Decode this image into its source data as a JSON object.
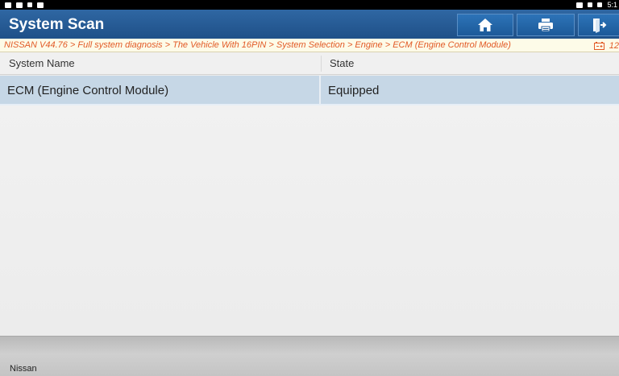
{
  "status_bar": {
    "time": "5:1",
    "left_icons": [
      "notification-icon",
      "image-icon",
      "usb-icon",
      "video-icon"
    ],
    "right_icons": [
      "cast-icon",
      "bluetooth-icon",
      "battery-icon"
    ]
  },
  "header": {
    "title": "System Scan",
    "buttons": [
      "home-icon",
      "print-icon",
      "exit-icon"
    ]
  },
  "breadcrumb": {
    "path": "NISSAN V44.76 > Full system diagnosis > The Vehicle With 16PIN > System Selection > Engine > ECM (Engine Control Module)",
    "right_text": "12"
  },
  "table": {
    "columns": [
      "System Name",
      "State"
    ],
    "rows": [
      {
        "system_name": "ECM (Engine Control Module)",
        "state": "Equipped"
      }
    ]
  },
  "footer": {
    "brand": "Nissan"
  },
  "colors": {
    "header": "#1f5088",
    "breadcrumb_text": "#e25a26",
    "selected_row": "#c6d7e6"
  }
}
